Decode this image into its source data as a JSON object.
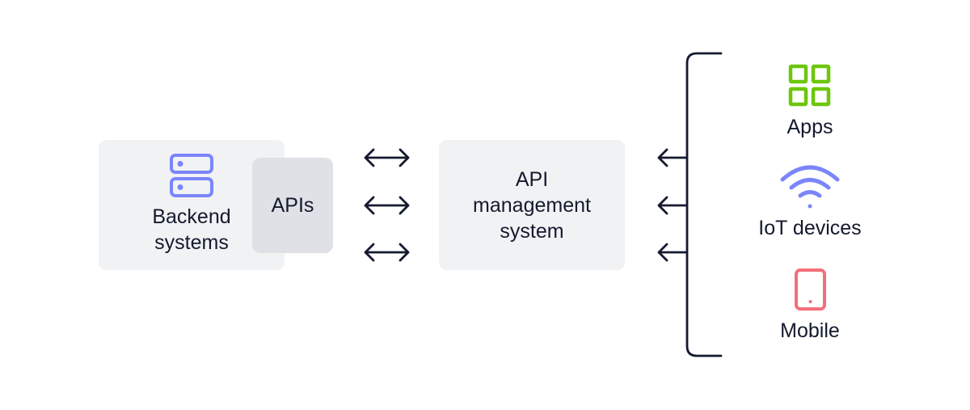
{
  "backend": {
    "label_line1": "Backend",
    "label_line2": "systems",
    "icon": "server-icon"
  },
  "apis": {
    "label": "APIs"
  },
  "api_management": {
    "line1": "API",
    "line2": "management",
    "line3": "system"
  },
  "clients": [
    {
      "label": "Apps",
      "icon": "apps-grid-icon",
      "color": "#6cc70a"
    },
    {
      "label": "IoT devices",
      "icon": "wifi-icon",
      "color": "#7b86fb"
    },
    {
      "label": "Mobile",
      "icon": "mobile-phone-icon",
      "color": "#f0707a"
    }
  ],
  "colors": {
    "box": "#f1f2f4",
    "apis_box": "#dfe1e6",
    "server_icon": "#7b86fb",
    "line": "#141a2e"
  }
}
